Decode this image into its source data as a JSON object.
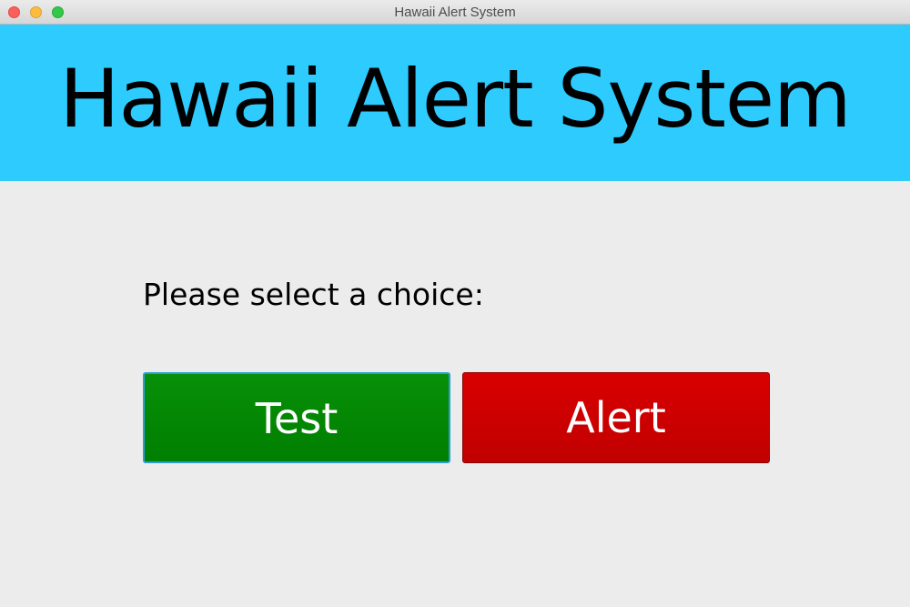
{
  "window": {
    "title": "Hawaii Alert System"
  },
  "banner": {
    "title": "Hawaii Alert System",
    "color": "#2ecbff"
  },
  "main": {
    "prompt": "Please select a choice:",
    "buttons": [
      {
        "label": "Test",
        "color": "#008800"
      },
      {
        "label": "Alert",
        "color": "#cc0000"
      }
    ]
  }
}
